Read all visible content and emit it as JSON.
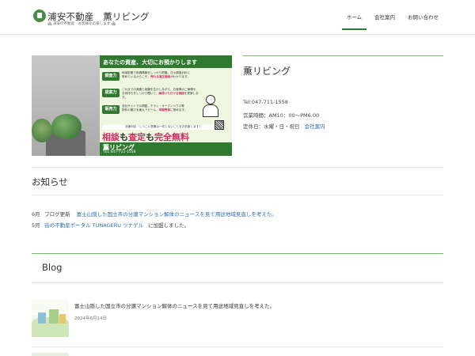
{
  "header": {
    "site_title": "浦安不動産　薫リビング",
    "tagline": "🏘 浦安の不動産　お客様を応援します 🏘",
    "nav": [
      {
        "label": "ホーム",
        "active": true
      },
      {
        "label": "会社案内",
        "active": false
      },
      {
        "label": "お問い合わせ",
        "active": false
      }
    ]
  },
  "hero": {
    "banner_top": "あなたの資産、大切にお預かりします",
    "features": [
      {
        "tag": "調査力",
        "text": "地域密着で相場情報をしっかり把握。日々調査分析に",
        "text2": "努めているからこそ、",
        "highlight": "売れる適正価格",
        "text3": "がわかります。"
      },
      {
        "tag": "提案力",
        "text": "これまでの実績と経験を生かしながら、お客様のご事情や",
        "text2": "お気持ちをしっかり聞いて、",
        "highlight": "納得いただける価値",
        "text3": "を提案します。"
      },
      {
        "tag": "販売力",
        "text": "自社サイトでの掲載、チラシ・オープンハウス等",
        "text2": "物件の魅力を最大アピール、",
        "highlight": "早期売却",
        "text3": "に努めます。"
      }
    ],
    "note": "迅速対応・しつこい営業は一切しないことをお約束します！",
    "big_text_a": "相談",
    "big_k1": "も",
    "big_text_b": "査定",
    "big_k2": "も",
    "big_text_c": "完全無料",
    "brand": "薫リビング",
    "tel": "TEL 047-711-1558"
  },
  "company": {
    "name": "薫リビング",
    "tel": "Tel:047-711-1558",
    "hours": "営業時間：AM10：00～PM6:00",
    "holiday": "定休日：水曜・日・祝日",
    "company_link": "会社案内"
  },
  "news": {
    "title": "お知らせ",
    "items": [
      {
        "month": "6月",
        "category": "ブログ更新",
        "link": "富士山隠した国立市の分譲マンション解体のニュースを見て用途地域見直しを考えた。",
        "suffix": ""
      },
      {
        "month": "5月",
        "category": "",
        "link": "街の不動産ポータル TUNAGERU ツナゲル",
        "suffix": "に加盟しました。"
      }
    ]
  },
  "blog": {
    "title": "Blog",
    "posts": [
      {
        "title": "富士山隠した国立市の分譲マンション解体のニュースを見て用途地域見直しを考えた。",
        "date": "2024年6月14日"
      }
    ]
  }
}
